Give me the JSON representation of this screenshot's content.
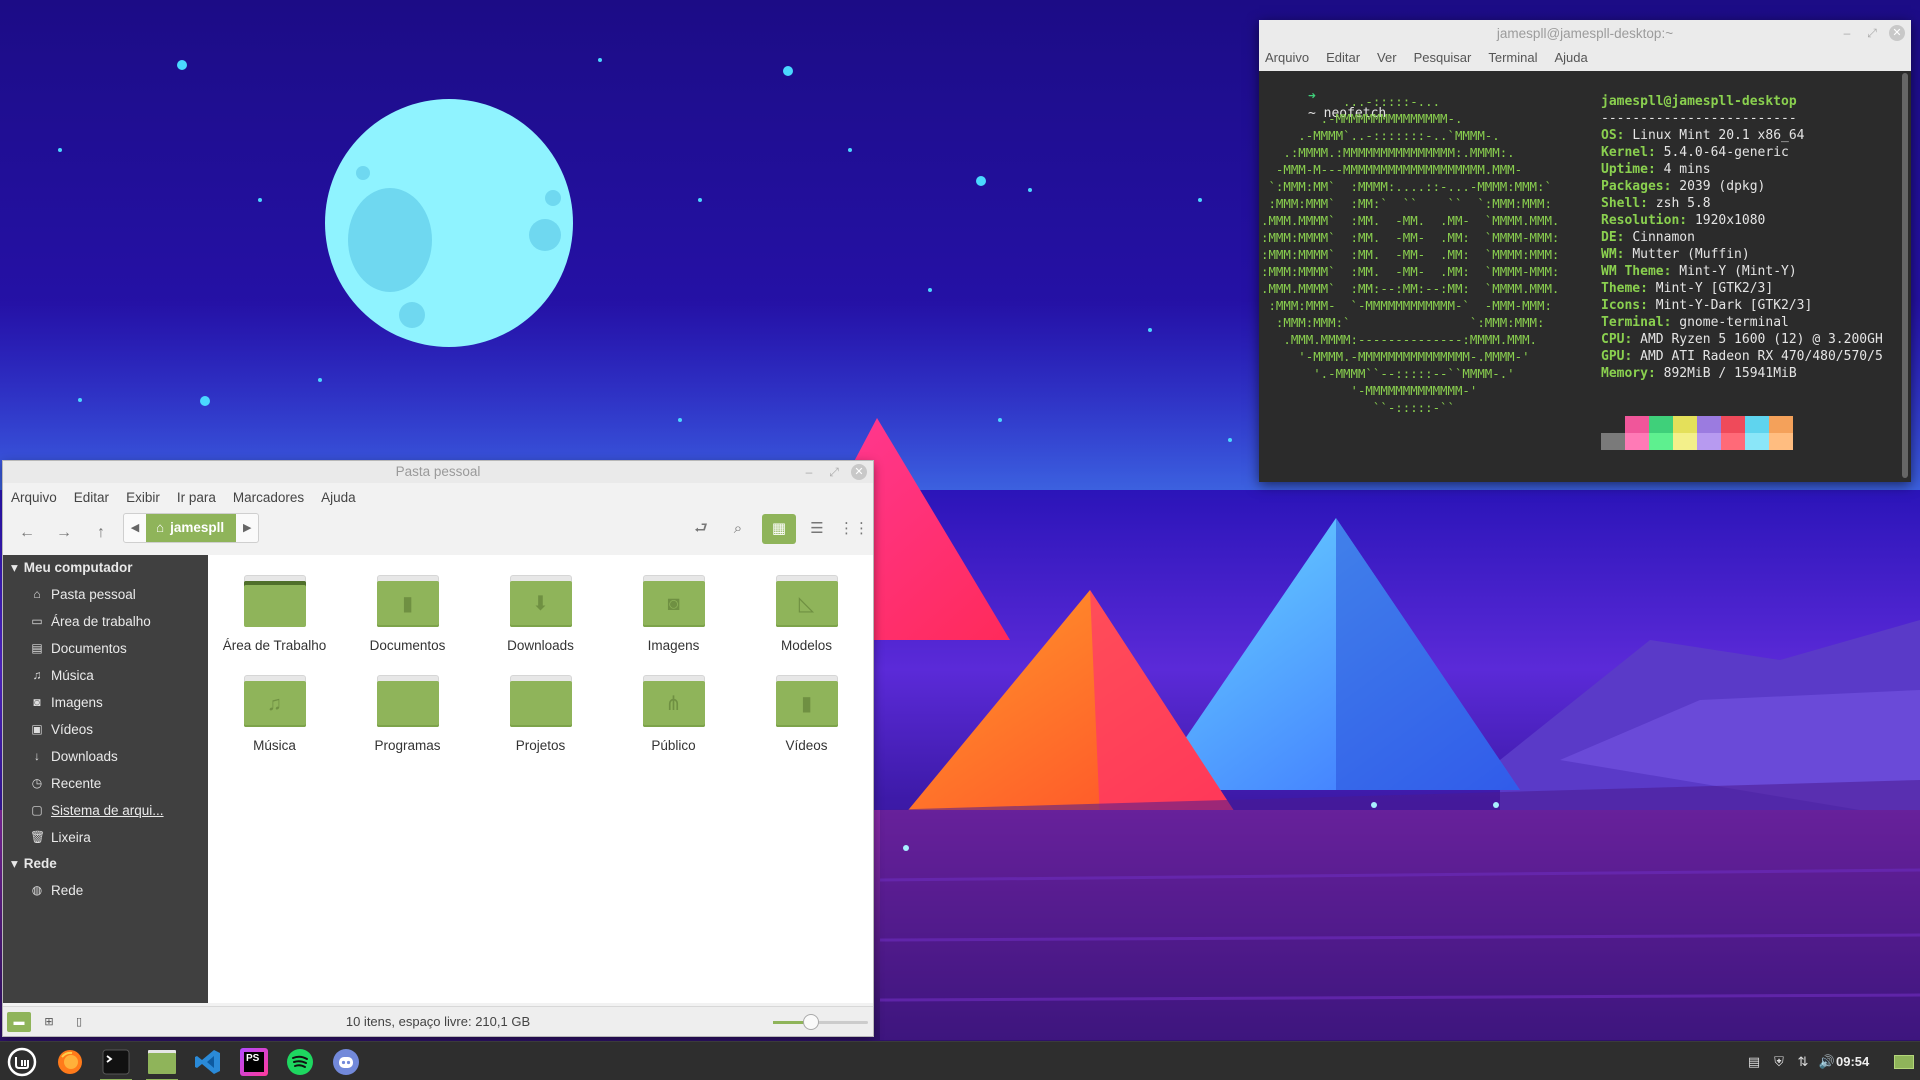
{
  "file_manager": {
    "title": "Pasta pessoal",
    "menu": [
      "Arquivo",
      "Editar",
      "Exibir",
      "Ir para",
      "Marcadores",
      "Ajuda"
    ],
    "location": "jamespll",
    "sidebar": {
      "computer_header": "Meu computador",
      "computer_items": [
        {
          "label": "Pasta pessoal",
          "icon": "home-icon"
        },
        {
          "label": "Área de trabalho",
          "icon": "desktop-icon"
        },
        {
          "label": "Documentos",
          "icon": "document-icon"
        },
        {
          "label": "Música",
          "icon": "music-icon"
        },
        {
          "label": "Imagens",
          "icon": "camera-icon"
        },
        {
          "label": "Vídeos",
          "icon": "video-icon"
        },
        {
          "label": "Downloads",
          "icon": "download-icon"
        },
        {
          "label": "Recente",
          "icon": "clock-icon"
        },
        {
          "label": "Sistema de arqui...",
          "icon": "drive-icon"
        },
        {
          "label": "Lixeira",
          "icon": "trash-icon"
        }
      ],
      "network_header": "Rede",
      "network_items": [
        {
          "label": "Rede",
          "icon": "network-icon"
        }
      ]
    },
    "folders": [
      {
        "label": "Área de Trabalho",
        "icon": "desktop-folder-icon"
      },
      {
        "label": "Documentos",
        "icon": "documents-folder-icon"
      },
      {
        "label": "Downloads",
        "icon": "downloads-folder-icon"
      },
      {
        "label": "Imagens",
        "icon": "pictures-folder-icon"
      },
      {
        "label": "Modelos",
        "icon": "templates-folder-icon"
      },
      {
        "label": "Música",
        "icon": "music-folder-icon"
      },
      {
        "label": "Programas",
        "icon": "folder-icon"
      },
      {
        "label": "Projetos",
        "icon": "folder-icon"
      },
      {
        "label": "Público",
        "icon": "public-folder-icon"
      },
      {
        "label": "Vídeos",
        "icon": "videos-folder-icon"
      }
    ],
    "status": "10 itens, espaço livre: 210,1 GB",
    "zoom_level": 0.4,
    "accent": "#8fb45a"
  },
  "terminal": {
    "title": "jamespll@jamespll-desktop:~",
    "menu": [
      "Arquivo",
      "Editar",
      "Ver",
      "Pesquisar",
      "Terminal",
      "Ajuda"
    ],
    "prompt_symbol": "➜",
    "command_line": "~ neofetch",
    "second_prompt": "~",
    "ascii_logo": "           ...-:::::-...\n        .-MMMMMMMMMMMMMMM-.\n     .-MMMM`..-:::::::-..`MMMM-.\n   .:MMMM.:MMMMMMMMMMMMMMM:.MMMM:.\n  -MMM-M---MMMMMMMMMMMMMMMMMMM.MMM-\n `:MMM:MM`  :MMMM:....::-...-MMMM:MMM:`\n :MMM:MMM`  :MM:`  ``    ``  `:MMM:MMM:\n.MMM.MMMM`  :MM.  -MM.  .MM-  `MMMM.MMM.\n:MMM:MMMM`  :MM.  -MM-  .MM:  `MMMM-MMM:\n:MMM:MMMM`  :MM.  -MM-  .MM:  `MMMM:MMM:\n:MMM:MMMM`  :MM.  -MM-  .MM:  `MMMM-MMM:\n.MMM.MMMM`  :MM:--:MM:--:MM:  `MMMM.MMM.\n :MMM:MMM-  `-MMMMMMMMMMMM-`  -MMM-MMM:\n  :MMM:MMM:`                `:MMM:MMM:\n   .MMM.MMMM:--------------:MMMM.MMM.\n     '-MMMM.-MMMMMMMMMMMMMMM-.MMMM-'\n       '.-MMMM``--:::::--``MMMM-.'\n            '-MMMMMMMMMMMMM-'\n               ``-:::::-``",
    "header": "jamespll@jamespll-desktop",
    "separator": "-------------------------",
    "info": [
      {
        "key": "OS",
        "value": "Linux Mint 20.1 x86_64"
      },
      {
        "key": "Kernel",
        "value": "5.4.0-64-generic"
      },
      {
        "key": "Uptime",
        "value": "4 mins"
      },
      {
        "key": "Packages",
        "value": "2039 (dpkg)"
      },
      {
        "key": "Shell",
        "value": "zsh 5.8"
      },
      {
        "key": "Resolution",
        "value": "1920x1080"
      },
      {
        "key": "DE",
        "value": "Cinnamon"
      },
      {
        "key": "WM",
        "value": "Mutter (Muffin)"
      },
      {
        "key": "WM Theme",
        "value": "Mint-Y (Mint-Y)"
      },
      {
        "key": "Theme",
        "value": "Mint-Y [GTK2/3]"
      },
      {
        "key": "Icons",
        "value": "Mint-Y-Dark [GTK2/3]"
      },
      {
        "key": "Terminal",
        "value": "gnome-terminal"
      },
      {
        "key": "CPU",
        "value": "AMD Ryzen 5 1600 (12) @ 3.200GH"
      },
      {
        "key": "GPU",
        "value": "AMD ATI Radeon RX 470/480/570/5"
      },
      {
        "key": "Memory",
        "value": "892MiB / 15941MiB"
      }
    ],
    "palette_row1": [
      "#2b2b2b",
      "#f0569a",
      "#3fd07a",
      "#e4e05a",
      "#9b7be0",
      "#ef4a5a",
      "#5fd4ee",
      "#f4a15a"
    ],
    "palette_row2": [
      "#7a7a7a",
      "#ff7ab6",
      "#5ef08f",
      "#f3f08a",
      "#b79af0",
      "#ff6a78",
      "#8ae6f8",
      "#ffbd80"
    ]
  },
  "taskbar": {
    "launchers": [
      {
        "name": "menu-button",
        "icon": "mint-logo-icon",
        "active": false
      },
      {
        "name": "firefox-launcher",
        "icon": "firefox-icon",
        "active": false
      },
      {
        "name": "terminal-launcher",
        "icon": "terminal-icon",
        "active": true
      },
      {
        "name": "files-launcher",
        "icon": "folder-icon",
        "active": true
      },
      {
        "name": "vscode-launcher",
        "icon": "vscode-icon",
        "active": false
      },
      {
        "name": "phpstorm-launcher",
        "icon": "phpstorm-icon",
        "active": false
      },
      {
        "name": "spotify-launcher",
        "icon": "spotify-icon",
        "active": false
      },
      {
        "name": "discord-launcher",
        "icon": "discord-icon",
        "active": false
      }
    ],
    "phpstorm_text": "PS",
    "clock": "09:54"
  }
}
